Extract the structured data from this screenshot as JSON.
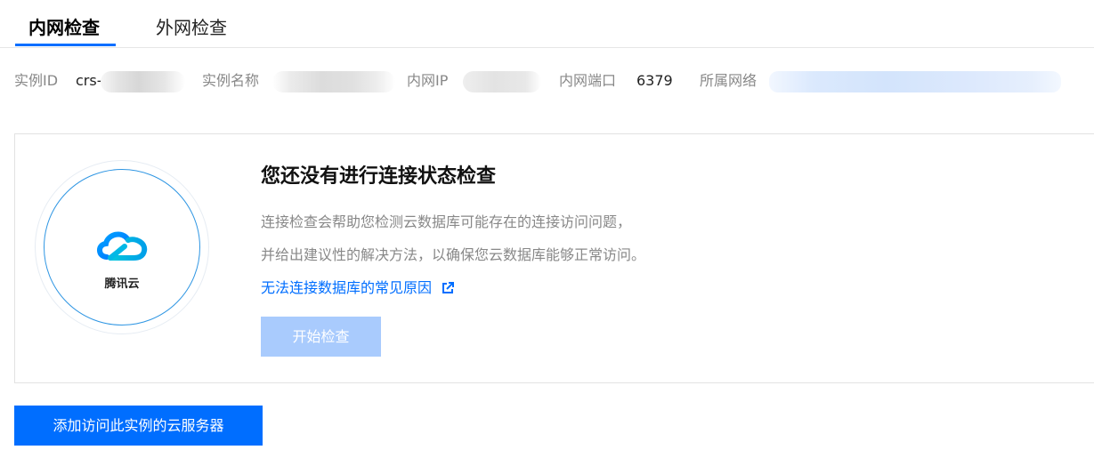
{
  "tabs": [
    {
      "label": "内网检查",
      "active": true
    },
    {
      "label": "外网检查",
      "active": false
    }
  ],
  "info": {
    "instance_id_label": "实例ID",
    "instance_id_value": "crs-",
    "instance_name_label": "实例名称",
    "private_ip_label": "内网IP",
    "private_port_label": "内网端口",
    "private_port_value": "6379",
    "network_label": "所属网络"
  },
  "card": {
    "logo_text": "腾讯云",
    "title": "您还没有进行连接状态检查",
    "description_line1": "连接检查会帮助您检测云数据库可能存在的连接访问问题，",
    "description_line2": "并给出建议性的解决方法，以确保您云数据库能够正常访问。",
    "faq_link": "无法连接数据库的常见原因",
    "start_button": "开始检查"
  },
  "add_button": "添加访问此实例的云服务器",
  "colors": {
    "primary": "#006eff",
    "disabled_button": "#a9cbfd",
    "muted_text": "#888888"
  },
  "icons": [
    "external-link-icon",
    "tencent-cloud-logo-icon"
  ]
}
